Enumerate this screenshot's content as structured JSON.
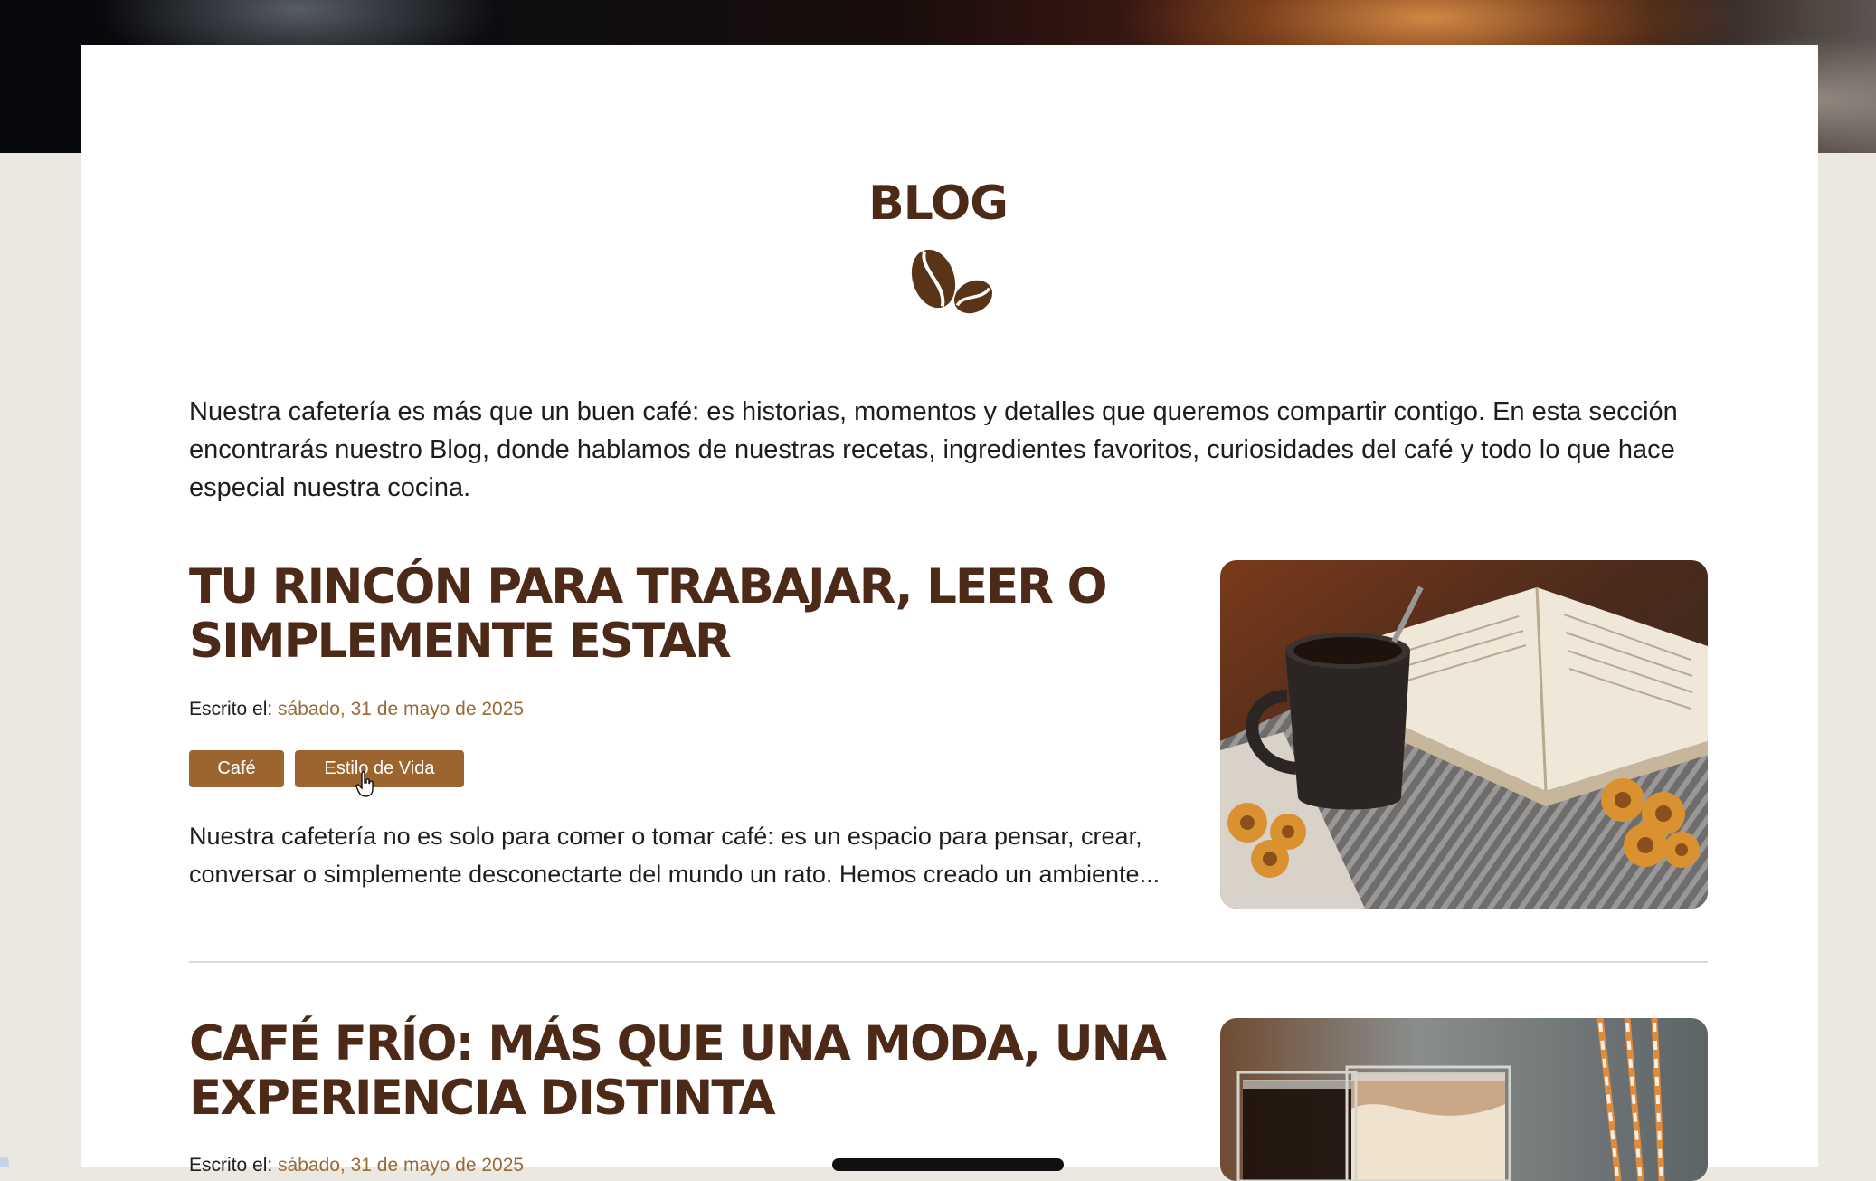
{
  "page": {
    "title": "BLOG",
    "intro": "Nuestra cafetería es más que un buen café: es historias, momentos y detalles que queremos compartir contigo. En esta sección encontrarás nuestro Blog, donde hablamos de nuestras recetas, ingredientes favoritos, curiosidades del café y todo lo que hace especial nuestra cocina."
  },
  "icons": {
    "divider_icon": "coffee-beans-icon"
  },
  "colors": {
    "heading": "#4d2a18",
    "tag_background": "#9c642f",
    "date_text": "#9a6a34",
    "page_background": "#ebe8e1",
    "card_background": "#ffffff"
  },
  "posts": [
    {
      "title_line1": "TU RINCÓN PARA TRABAJAR, LEER O",
      "title_line2": "SIMPLEMENTE ESTAR",
      "meta_label": "Escrito el: ",
      "date": "sábado, 31 de mayo de 2025",
      "tags": [
        "Café",
        "Estilo de Vida"
      ],
      "excerpt_line1": "Nuestra cafetería no es solo para comer o tomar café: es un espacio para pensar, crear,",
      "excerpt_line2": "conversar o simplemente desconectarte del mundo un rato. Hemos creado un ambiente...",
      "image_icon": "coffee-and-book-photo"
    },
    {
      "title_line1": "CAFÉ FRÍO: MÁS QUE UNA MODA, UNA",
      "title_line2": "EXPERIENCIA DISTINTA",
      "meta_label": "Escrito el: ",
      "date": "sábado, 31 de mayo de 2025",
      "image_icon": "iced-coffee-photo"
    }
  ]
}
